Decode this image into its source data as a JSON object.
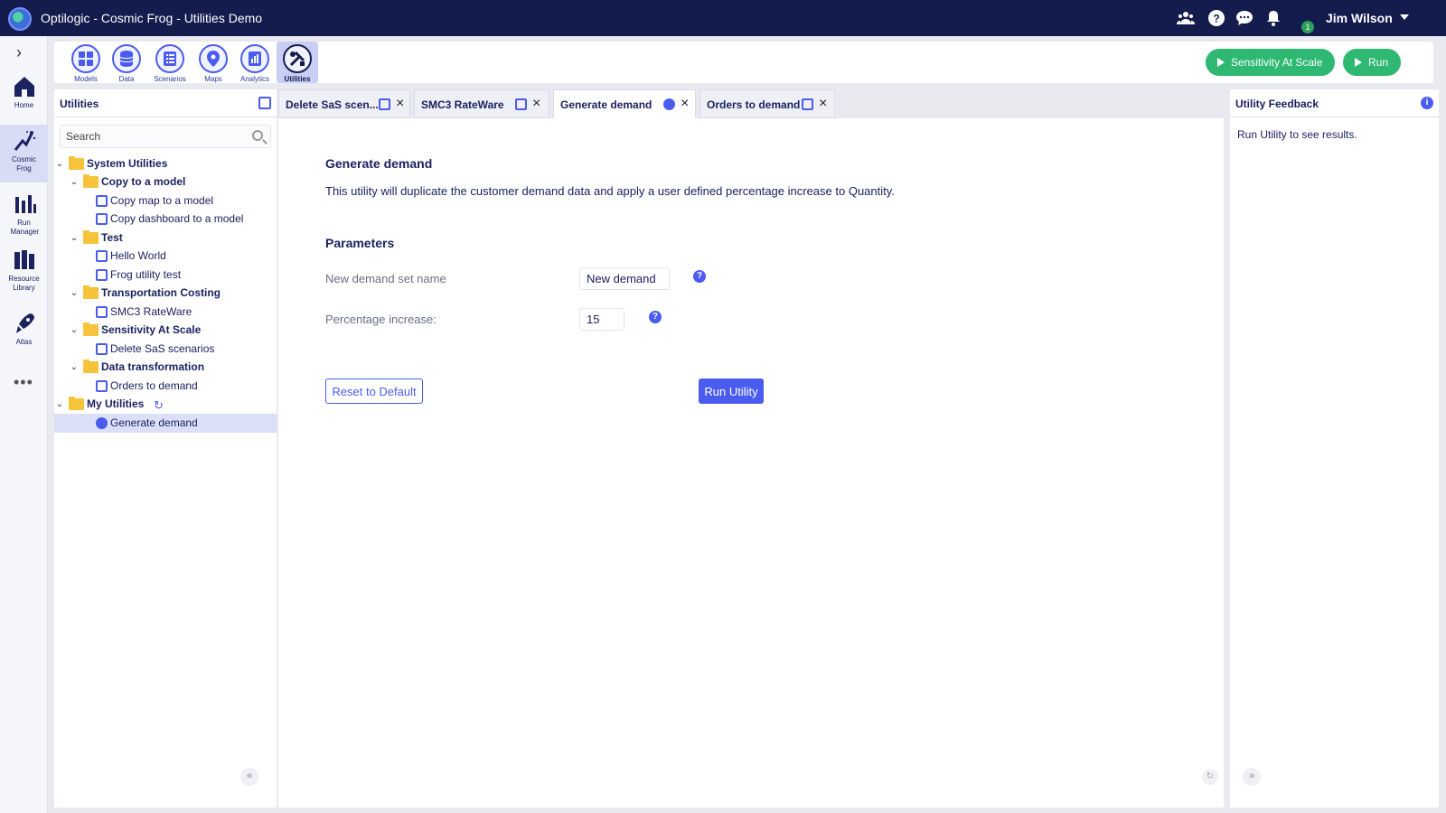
{
  "app": {
    "title": "Optilogic - Cosmic Frog - Utilities Demo",
    "user_name": "Jim Wilson",
    "notification_count": "1"
  },
  "rail": {
    "items": [
      {
        "label": "Home",
        "icon": "home-icon"
      },
      {
        "label": "Cosmic Frog",
        "icon": "cosmic-frog-icon"
      },
      {
        "label": "Run Manager",
        "icon": "run-manager-icon"
      },
      {
        "label": "Resource Library",
        "icon": "resource-library-icon"
      },
      {
        "label": "Atlas",
        "icon": "atlas-icon"
      }
    ]
  },
  "modules": [
    {
      "label": "Models",
      "icon": "grid-icon"
    },
    {
      "label": "Data",
      "icon": "database-icon"
    },
    {
      "label": "Scenarios",
      "icon": "list-icon"
    },
    {
      "label": "Maps",
      "icon": "map-pin-icon"
    },
    {
      "label": "Analytics",
      "icon": "chart-icon"
    },
    {
      "label": "Utilities",
      "icon": "tools-icon"
    }
  ],
  "actions": {
    "sensitivity_label": "Sensitivity At Scale",
    "run_label": "Run"
  },
  "utilities_panel": {
    "title": "Utilities",
    "search_placeholder": "Search",
    "tree": [
      {
        "label": "System Utilities",
        "type": "folder"
      },
      {
        "label": "Copy to a model",
        "type": "folder"
      },
      {
        "label": "Copy map to a model",
        "type": "utility"
      },
      {
        "label": "Copy dashboard to a model",
        "type": "utility"
      },
      {
        "label": "Test",
        "type": "folder"
      },
      {
        "label": "Hello World",
        "type": "utility"
      },
      {
        "label": "Frog utility test",
        "type": "utility"
      },
      {
        "label": "Transportation Costing",
        "type": "folder"
      },
      {
        "label": "SMC3 RateWare",
        "type": "utility"
      },
      {
        "label": "Sensitivity At Scale",
        "type": "folder"
      },
      {
        "label": "Delete SaS scenarios",
        "type": "utility"
      },
      {
        "label": "Data transformation",
        "type": "folder"
      },
      {
        "label": "Orders to demand",
        "type": "utility"
      },
      {
        "label": "My Utilities",
        "type": "folder"
      },
      {
        "label": "Generate demand",
        "type": "utility"
      }
    ]
  },
  "tabs": [
    {
      "label": "Delete SaS scen..."
    },
    {
      "label": "SMC3 RateWare"
    },
    {
      "label": "Generate demand"
    },
    {
      "label": "Orders to demand"
    }
  ],
  "main": {
    "heading": "Generate demand",
    "description": "This utility will duplicate the customer demand data and apply a user defined percentage increase to Quantity.",
    "parameters_heading": "Parameters",
    "param1_label": "New demand set name",
    "param1_value": "New demand",
    "param2_label": "Percentage increase:",
    "param2_value": "15",
    "reset_label": "Reset to Default",
    "run_label": "Run Utility"
  },
  "feedback": {
    "title": "Utility Feedback",
    "message": "Run Utility to see results."
  },
  "colors": {
    "topbar": "#141b4d",
    "accent": "#4a5cf0",
    "run_green": "#2eb872",
    "folder": "#f6c33b"
  }
}
